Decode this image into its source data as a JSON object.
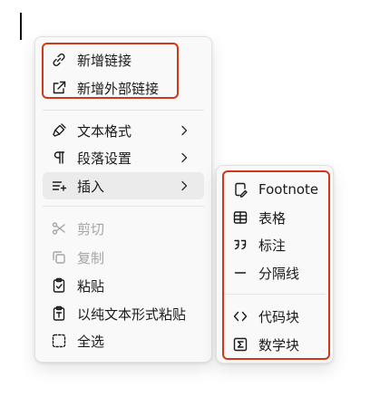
{
  "main_menu": {
    "group_links": [
      {
        "icon": "link-icon",
        "label": "新增链接"
      },
      {
        "icon": "external-link-icon",
        "label": "新增外部链接"
      }
    ],
    "group_format": [
      {
        "icon": "paintbrush-icon",
        "label": "文本格式",
        "has_submenu": true
      },
      {
        "icon": "paragraph-icon",
        "label": "段落设置",
        "has_submenu": true
      },
      {
        "icon": "insert-icon",
        "label": "插入",
        "has_submenu": true,
        "state": "hovered"
      }
    ],
    "group_clipboard": [
      {
        "icon": "scissors-icon",
        "label": "剪切",
        "disabled": true
      },
      {
        "icon": "copy-icon",
        "label": "复制",
        "disabled": true
      },
      {
        "icon": "clipboard-icon",
        "label": "粘贴"
      },
      {
        "icon": "clipboard-text-icon",
        "label": "以纯文本形式粘贴"
      },
      {
        "icon": "select-all-icon",
        "label": "全选"
      }
    ]
  },
  "submenu_insert": {
    "group_blocks": [
      {
        "icon": "footnote-icon",
        "label": "Footnote"
      },
      {
        "icon": "table-icon",
        "label": "表格"
      },
      {
        "icon": "quote-icon",
        "label": "标注"
      },
      {
        "icon": "horizontal-rule-icon",
        "label": "分隔线"
      }
    ],
    "group_code": [
      {
        "icon": "code-icon",
        "label": "代码块"
      },
      {
        "icon": "sigma-icon",
        "label": "数学块"
      }
    ]
  },
  "colors": {
    "menu_background": "#f9f9f9",
    "hover_background": "#ebebeb",
    "highlight_border": "#d0381a",
    "disabled_text": "#a5a5a5"
  }
}
